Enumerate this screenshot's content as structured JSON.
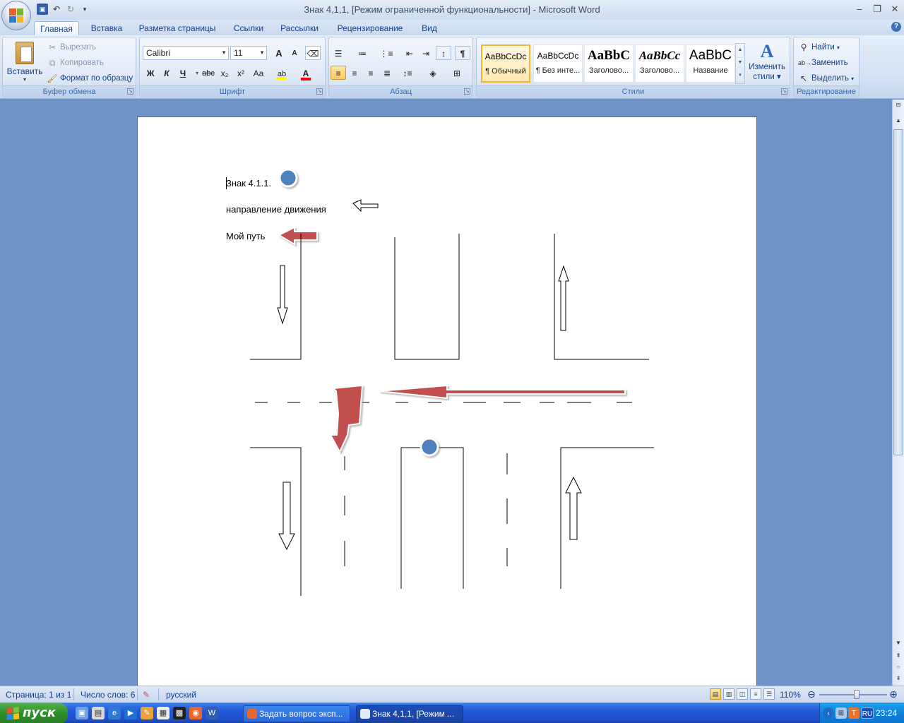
{
  "window": {
    "title": "Знак 4,1,1, [Режим ограниченной функциональности] - Microsoft Word",
    "minimize": "‒",
    "restore": "❐",
    "close": "✕"
  },
  "tabs": [
    {
      "label": "Главная",
      "active": true
    },
    {
      "label": "Вставка"
    },
    {
      "label": "Разметка страницы"
    },
    {
      "label": "Ссылки"
    },
    {
      "label": "Рассылки"
    },
    {
      "label": "Рецензирование"
    },
    {
      "label": "Вид"
    }
  ],
  "clipboard": {
    "paste": "Вставить",
    "cut": "Вырезать",
    "copy": "Копировать",
    "format_painter": "Формат по образцу",
    "label": "Буфер обмена"
  },
  "font": {
    "name": "Calibri",
    "size": "11",
    "label": "Шрифт",
    "bold": "Ж",
    "italic": "К",
    "underline": "Ч",
    "strike": "abc",
    "subscript": "x₂",
    "superscript": "x²",
    "case": "Aa",
    "grow": "A",
    "shrink": "A"
  },
  "paragraph": {
    "label": "Абзац"
  },
  "styles": {
    "label": "Стили",
    "items": [
      {
        "sample": "AaBbCcDc",
        "name": "¶ Обычный",
        "selected": true
      },
      {
        "sample": "AaBbCcDc",
        "name": "¶ Без инте..."
      },
      {
        "sample": "AaBbC",
        "name": "Заголово..."
      },
      {
        "sample": "AaBbCc",
        "name": "Заголово..."
      },
      {
        "sample": "AaBbC",
        "name": "Название"
      }
    ],
    "change_styles_line1": "Изменить",
    "change_styles_line2": "стили"
  },
  "editing": {
    "label": "Редактирование",
    "find": "Найти",
    "replace": "Заменить",
    "select": "Выделить"
  },
  "document": {
    "line1": "Знак 4.1.1.",
    "line2": "направление движения",
    "line3": "Мой путь"
  },
  "status": {
    "page": "Страница: 1 из 1",
    "words": "Число слов: 6",
    "language": "русский",
    "zoom": "110%",
    "zoom_fraction": 0.55
  },
  "taskbar": {
    "start": "пуск",
    "tasks": [
      {
        "label": "Задать вопрос эксп..."
      },
      {
        "label": "Знак 4,1,1, [Режим ..."
      }
    ],
    "lang": "RU",
    "clock": "23:24"
  },
  "colors": {
    "red_arrow": "#c0504d",
    "blue_dot": "#4f81bd",
    "highlight": "#ffff00",
    "font_color": "#ff0000"
  }
}
